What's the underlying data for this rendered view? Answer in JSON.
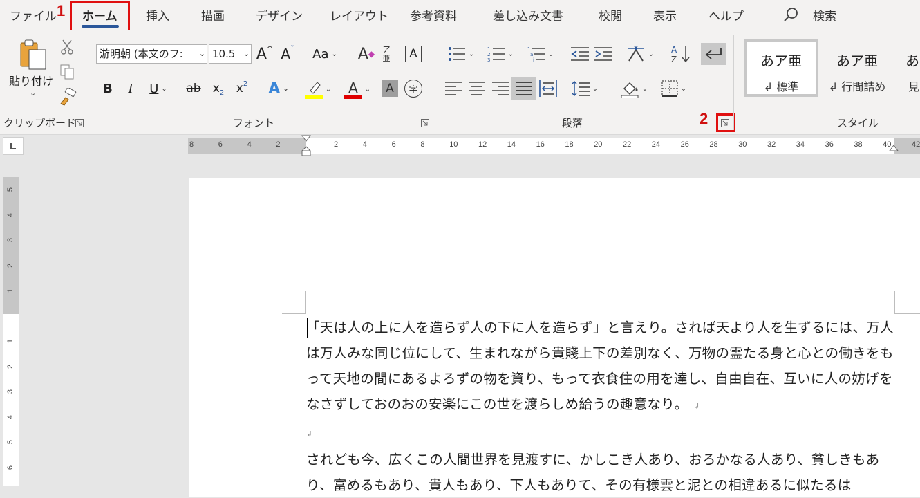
{
  "menu": {
    "tabs": [
      "ファイル",
      "ホーム",
      "挿入",
      "描画",
      "デザイン",
      "レイアウト",
      "参考資料",
      "差し込み文書",
      "校閲",
      "表示",
      "ヘルプ"
    ],
    "active_tab": "ホーム",
    "search_label": "検索"
  },
  "annotations": {
    "step1": "1",
    "step2": "2"
  },
  "ribbon": {
    "clipboard": {
      "paste_label": "貼り付け",
      "group_label": "クリップボード"
    },
    "font": {
      "font_name": "游明朝 (本文のフ:",
      "font_size": "10.5",
      "group_label": "フォント",
      "case_label": "Aa",
      "phonetic_label": "ア亜"
    },
    "paragraph": {
      "group_label": "段落"
    },
    "styles": {
      "group_label": "スタイル",
      "cards": [
        {
          "sample": "あア亜",
          "name": "↲ 標準"
        },
        {
          "sample": "あア亜",
          "name": "↲ 行間詰め"
        },
        {
          "sample": "あ",
          "name": "見"
        }
      ]
    }
  },
  "ruler": {
    "h_labels": [
      "8",
      "6",
      "4",
      "2",
      "",
      "2",
      "4",
      "6",
      "8",
      "10",
      "12",
      "14",
      "16",
      "18",
      "20",
      "22",
      "24",
      "26",
      "28",
      "30",
      "32",
      "34",
      "36",
      "38",
      "40",
      "42"
    ],
    "v_labels": [
      "5",
      "4",
      "3",
      "2",
      "1",
      "",
      "1",
      "2",
      "3",
      "4",
      "5",
      "6"
    ]
  },
  "document": {
    "paragraphs": [
      "「天は人の上に人を造らず人の下に人を造らず」と言えり。されば天より人を生ずるには、万人は万人みな同じ位にして、生まれながら貴賤上下の差別なく、万物の霊たる身と心との働きをもって天地の間にあるよろずの物を資り、もって衣食住の用を達し、自由自在、互いに人の妨げをなさずしておのおの安楽にこの世を渡らしめ給うの趣意なり。",
      "",
      "されども今、広くこの人間世界を見渡すに、かしこき人あり、おろかなる人あり、貧しきもあり、富めるもあり、貴人もあり、下人もありて、その有様雲と泥との相違あるに似たるは"
    ],
    "paragraph_mark": "↲"
  },
  "colors": {
    "accent": "#2b579a",
    "highlight_box": "#e01010",
    "highlighter": "#ffff00",
    "font_color": "#e00000"
  }
}
